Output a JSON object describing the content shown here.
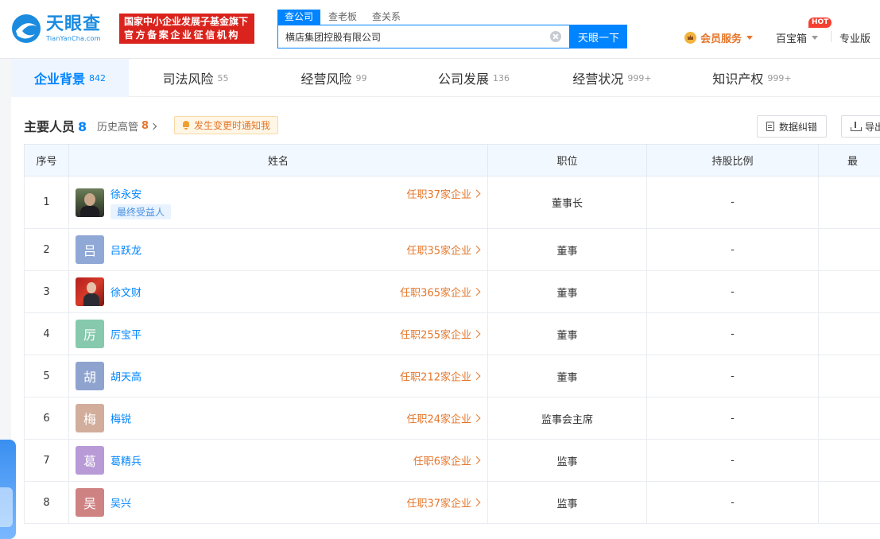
{
  "header": {
    "logo_cn": "天眼查",
    "logo_en": "TianYanCha.com",
    "fund_badge_line1": "国家中小企业发展子基金旗下",
    "fund_badge_line2": "官方备案企业征信机构",
    "search_tabs": [
      "查公司",
      "查老板",
      "查关系"
    ],
    "search_value": "横店集团控股有限公司",
    "search_button": "天眼一下",
    "member_label": "会员服务",
    "treasure_label": "百宝箱",
    "hot_badge": "HOT",
    "pro_label": "专业版"
  },
  "nav": {
    "tabs": [
      {
        "label": "企业背景",
        "count": "842"
      },
      {
        "label": "司法风险",
        "count": "55"
      },
      {
        "label": "经营风险",
        "count": "99"
      },
      {
        "label": "公司发展",
        "count": "136"
      },
      {
        "label": "经营状况",
        "count": "999+"
      },
      {
        "label": "知识产权",
        "count": "999+"
      }
    ]
  },
  "section": {
    "title": "主要人员",
    "count": "8",
    "history_label": "历史高管",
    "history_count": "8",
    "notify_label": "发生变更时通知我",
    "correct_button": "数据纠错",
    "export_button": "导出"
  },
  "table": {
    "headers": [
      "序号",
      "姓名",
      "职位",
      "持股比例",
      "最"
    ],
    "rows": [
      {
        "no": "1",
        "avatar": "",
        "avatar_color": "",
        "name": "徐永安",
        "tag": "最终受益人",
        "roles": "任职37家企业",
        "position": "董事长",
        "share": "-"
      },
      {
        "no": "2",
        "avatar": "吕",
        "avatar_color": "#8fa8d6",
        "name": "吕跃龙",
        "tag": "",
        "roles": "任职35家企业",
        "position": "董事",
        "share": "-"
      },
      {
        "no": "3",
        "avatar": "",
        "avatar_color": "",
        "name": "徐文财",
        "tag": "",
        "roles": "任职365家企业",
        "position": "董事",
        "share": "-"
      },
      {
        "no": "4",
        "avatar": "厉",
        "avatar_color": "#86c9ad",
        "name": "厉宝平",
        "tag": "",
        "roles": "任职255家企业",
        "position": "董事",
        "share": "-"
      },
      {
        "no": "5",
        "avatar": "胡",
        "avatar_color": "#8fa3cf",
        "name": "胡天高",
        "tag": "",
        "roles": "任职212家企业",
        "position": "董事",
        "share": "-"
      },
      {
        "no": "6",
        "avatar": "梅",
        "avatar_color": "#d2ad9c",
        "name": "梅锐",
        "tag": "",
        "roles": "任职24家企业",
        "position": "监事会主席",
        "share": "-"
      },
      {
        "no": "7",
        "avatar": "葛",
        "avatar_color": "#b79ad6",
        "name": "葛精兵",
        "tag": "",
        "roles": "任职6家企业",
        "position": "监事",
        "share": "-"
      },
      {
        "no": "8",
        "avatar": "吴",
        "avatar_color": "#cf8282",
        "name": "吴兴",
        "tag": "",
        "roles": "任职37家企业",
        "position": "监事",
        "share": "-"
      }
    ]
  }
}
